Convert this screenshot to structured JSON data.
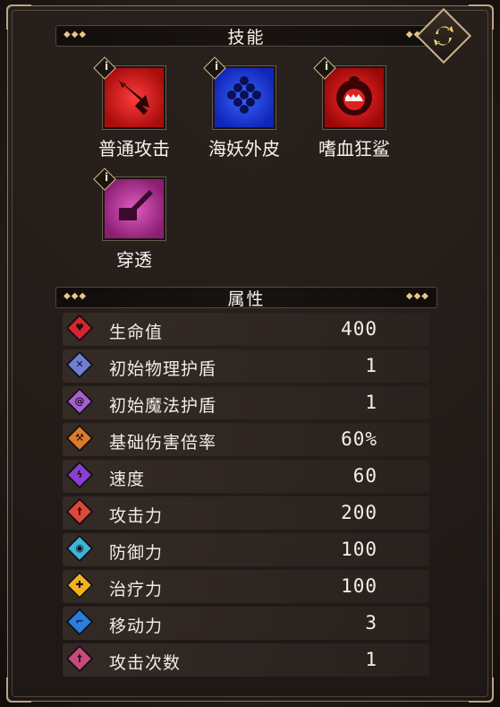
{
  "skills_header": "技能",
  "attributes_header": "属性",
  "skills": [
    {
      "name": "普通攻击",
      "icon": "sword-icon",
      "color": "#c41a1a",
      "info": "i"
    },
    {
      "name": "海妖外皮",
      "icon": "scales-icon",
      "color": "#1a3de0",
      "info": "i"
    },
    {
      "name": "嗜血狂鲨",
      "icon": "shark-icon",
      "color": "#d01414",
      "info": "i"
    },
    {
      "name": "穿透",
      "icon": "pierce-icon",
      "color": "#b52f8a",
      "info": "i"
    }
  ],
  "stats": [
    {
      "name": "生命值",
      "value": "400",
      "icon": "heart-icon",
      "color": "#d9232b"
    },
    {
      "name": "初始物理护盾",
      "value": "1",
      "icon": "physical-shield-icon",
      "color": "#6f7fd6"
    },
    {
      "name": "初始魔法护盾",
      "value": "1",
      "icon": "magic-shield-icon",
      "color": "#a760d3"
    },
    {
      "name": "基础伤害倍率",
      "value": "60%",
      "icon": "damage-multiplier-icon",
      "color": "#e07a2b"
    },
    {
      "name": "速度",
      "value": "60",
      "icon": "speed-icon",
      "color": "#8a3fd0"
    },
    {
      "name": "攻击力",
      "value": "200",
      "icon": "attack-icon",
      "color": "#e0473a"
    },
    {
      "name": "防御力",
      "value": "100",
      "icon": "defense-icon",
      "color": "#3fb3d8"
    },
    {
      "name": "治疗力",
      "value": "100",
      "icon": "heal-icon",
      "color": "#f2b21f"
    },
    {
      "name": "移动力",
      "value": "3",
      "icon": "move-icon",
      "color": "#2a7de0"
    },
    {
      "name": "攻击次数",
      "value": "1",
      "icon": "attack-count-icon",
      "color": "#c64a7a"
    }
  ]
}
